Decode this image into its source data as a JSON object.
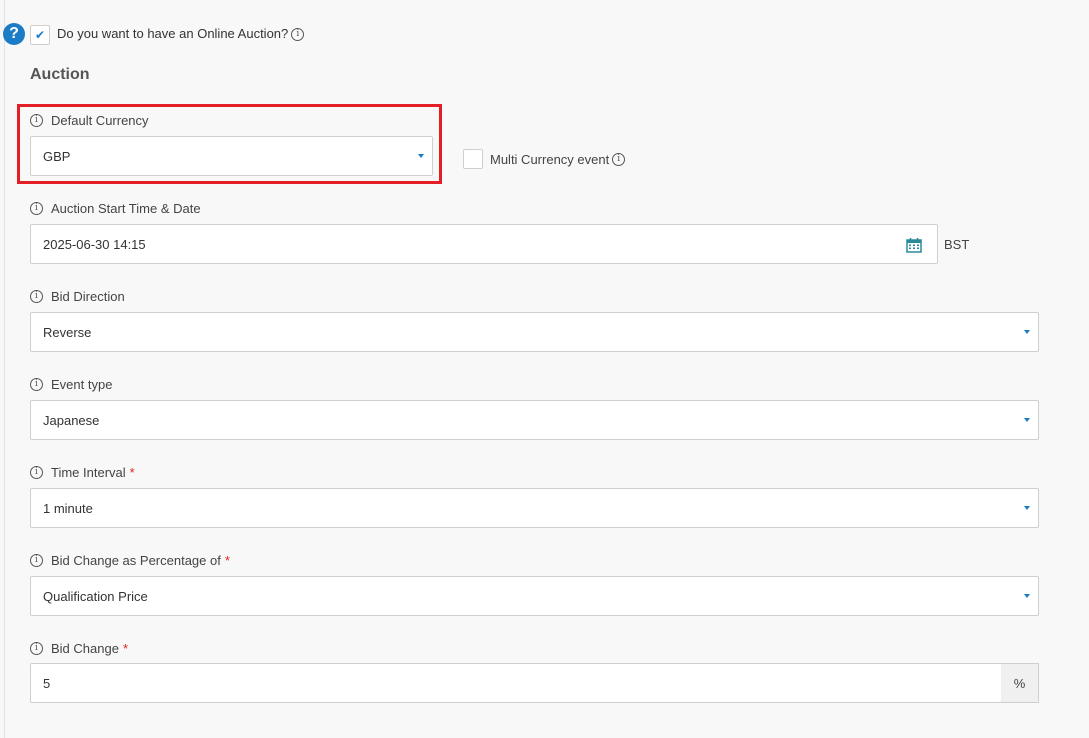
{
  "help": {
    "glyph": "?"
  },
  "online_auction": {
    "label": "Do you want to have an Online Auction?",
    "checked": true
  },
  "section": {
    "title": "Auction"
  },
  "default_currency": {
    "label": "Default Currency",
    "value": "GBP"
  },
  "multi_currency": {
    "label": "Multi Currency event",
    "checked": false
  },
  "start_time": {
    "label": "Auction Start Time & Date",
    "value": "2025-06-30 14:15",
    "timezone": "BST"
  },
  "bid_direction": {
    "label": "Bid Direction",
    "value": "Reverse"
  },
  "event_type": {
    "label": "Event type",
    "value": "Japanese"
  },
  "time_interval": {
    "label": "Time Interval",
    "required_mark": "*",
    "value": "1 minute"
  },
  "bid_change_pct": {
    "label": "Bid Change as Percentage of",
    "required_mark": "*",
    "value": "Qualification Price"
  },
  "bid_change": {
    "label": "Bid Change",
    "required_mark": "*",
    "value": "5",
    "unit": "%"
  },
  "info_glyph": "i",
  "colors": {
    "accent": "#1a7bc7",
    "highlight": "#e31e24",
    "required": "#d9261c"
  }
}
